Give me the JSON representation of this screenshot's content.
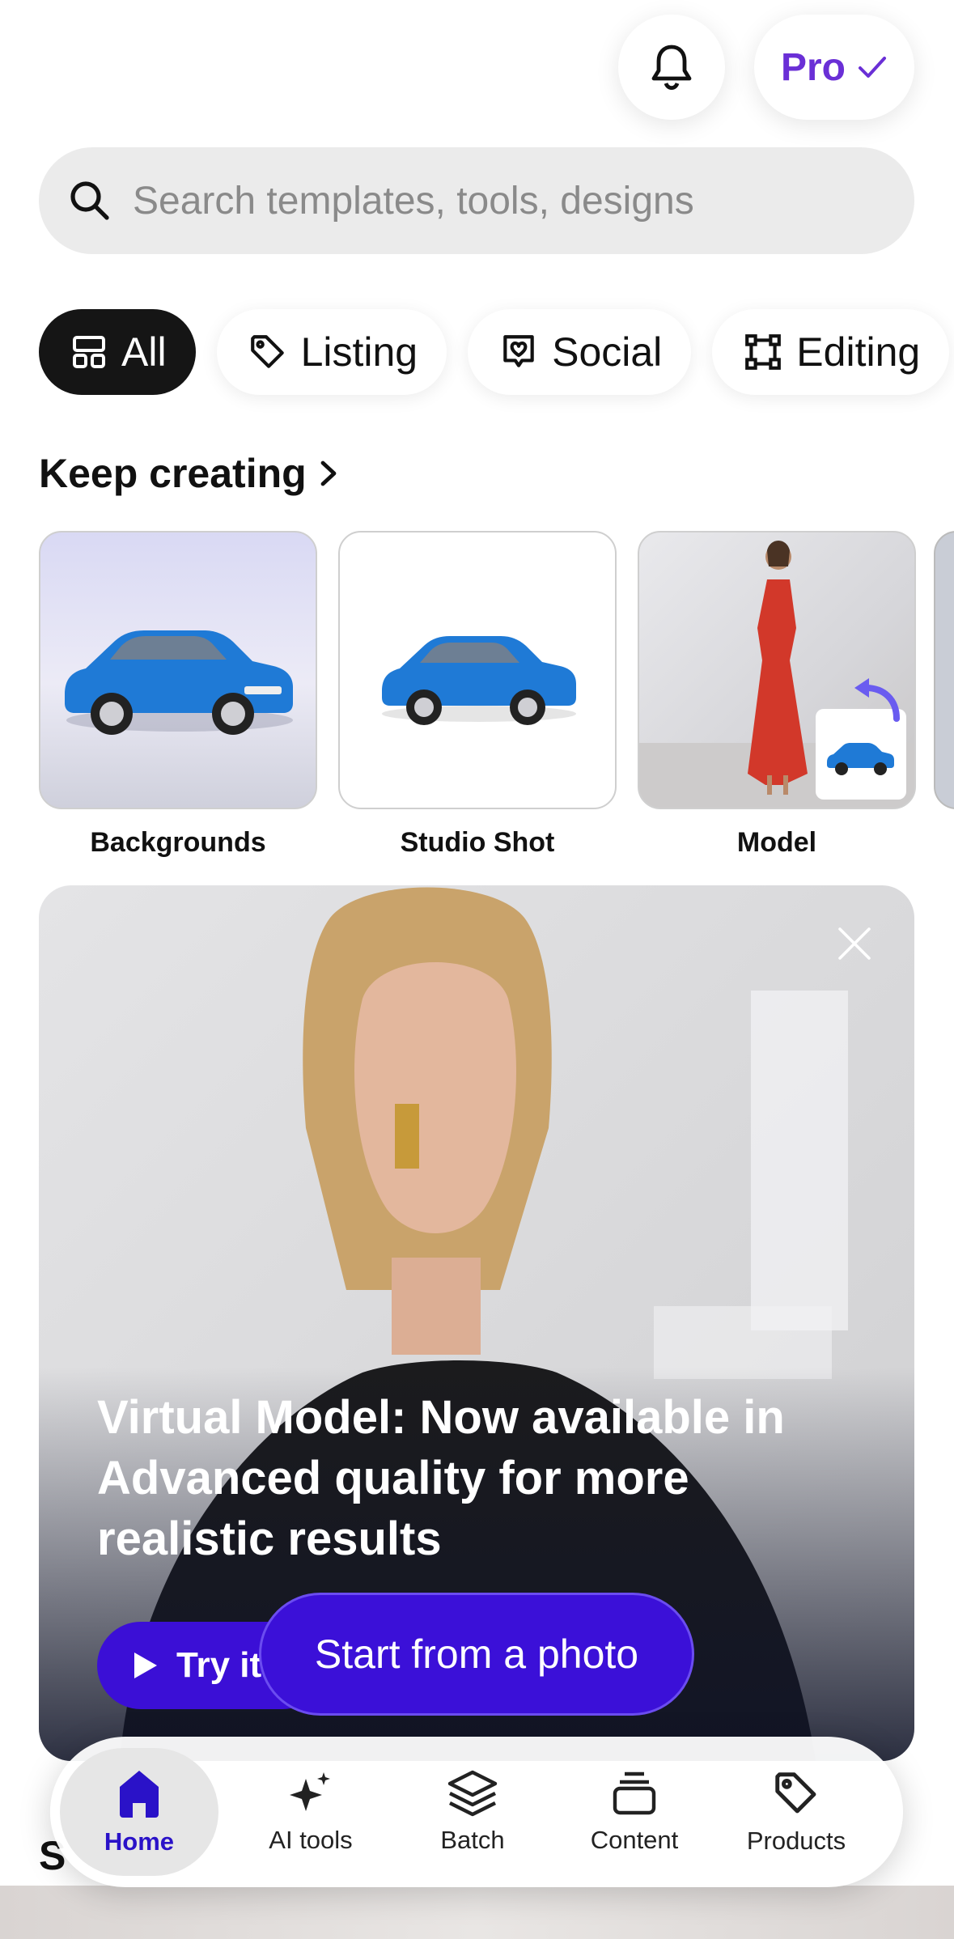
{
  "header": {
    "pro_label": "Pro"
  },
  "search": {
    "placeholder": "Search templates, tools, designs"
  },
  "chips": [
    {
      "label": "All",
      "icon": "grid-icon",
      "active": true
    },
    {
      "label": "Listing",
      "icon": "tag-icon"
    },
    {
      "label": "Social",
      "icon": "heart-badge-icon"
    },
    {
      "label": "Editing",
      "icon": "crop-icon"
    }
  ],
  "keep_creating": {
    "title": "Keep creating",
    "cards": [
      {
        "label": "Backgrounds"
      },
      {
        "label": "Studio Shot"
      },
      {
        "label": "Model"
      }
    ]
  },
  "banner": {
    "title": "Virtual Model: Now available in Advanced quality for more realistic results",
    "try_label": "Try it"
  },
  "start_button": {
    "label": "Start from a photo"
  },
  "nav": {
    "items": [
      {
        "label": "Home",
        "icon": "home-icon",
        "active": true
      },
      {
        "label": "AI tools",
        "icon": "sparkles-icon"
      },
      {
        "label": "Batch",
        "icon": "layers-icon"
      },
      {
        "label": "Content",
        "icon": "stack-icon"
      },
      {
        "label": "Products",
        "icon": "tag-icon"
      }
    ]
  },
  "section_peek": {
    "text": "S"
  },
  "colors": {
    "accent": "#3b10d8",
    "pro": "#6a2fd6",
    "chip_active": "#151515"
  }
}
